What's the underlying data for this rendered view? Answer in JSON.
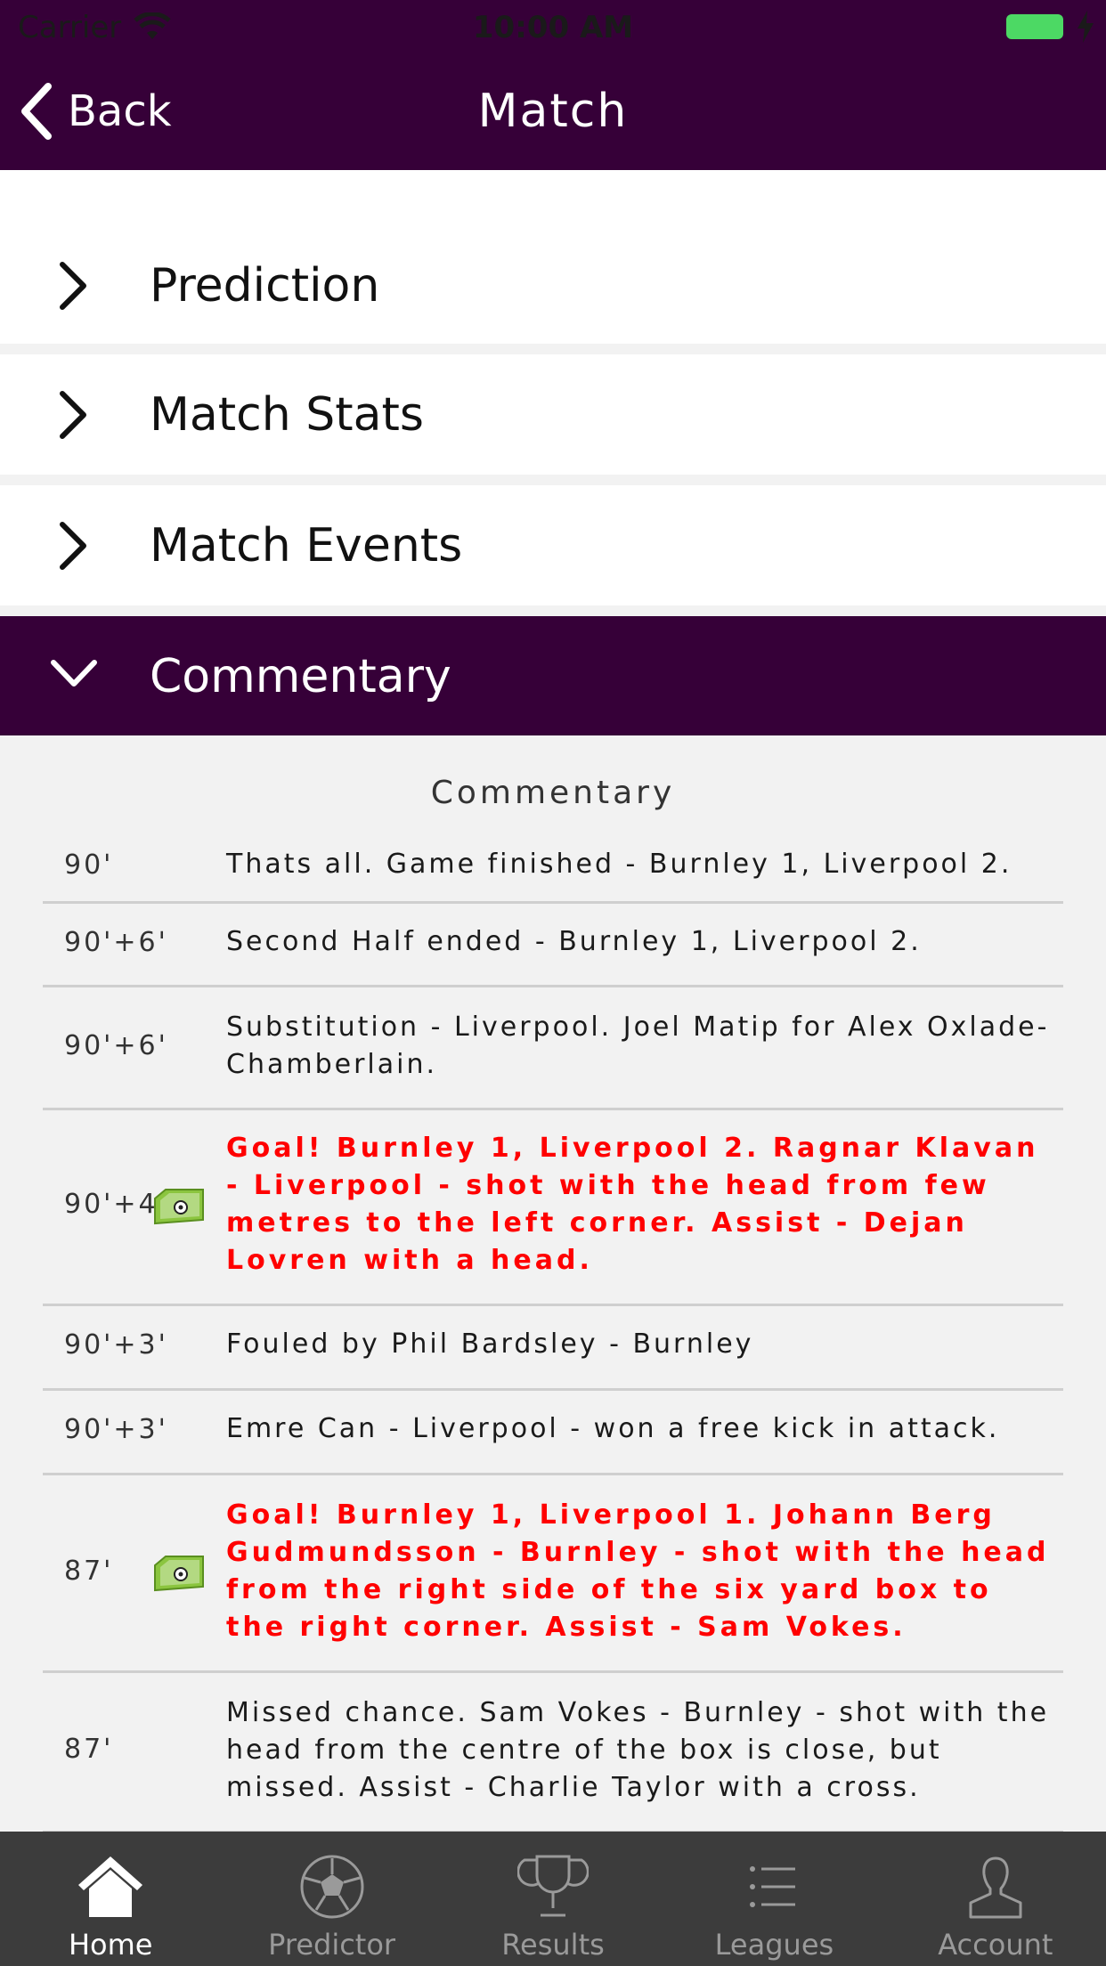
{
  "status_bar": {
    "carrier": "Carrier",
    "time": "10:00 AM"
  },
  "nav": {
    "back_label": "Back",
    "title": "Match"
  },
  "accordion": [
    {
      "label": "Prediction",
      "expanded": false
    },
    {
      "label": "Match Stats",
      "expanded": false
    },
    {
      "label": "Match Events",
      "expanded": false
    },
    {
      "label": "Commentary",
      "expanded": true
    }
  ],
  "commentary": {
    "header": "Commentary",
    "rows": [
      {
        "minute": "90'",
        "text": "Thats all. Game finished - Burnley 1, Liverpool 2.",
        "goal": false
      },
      {
        "minute": "90'+6'",
        "text": "Second Half ended - Burnley 1, Liverpool 2.",
        "goal": false
      },
      {
        "minute": "90'+6'",
        "text": "Substitution - Liverpool. Joel Matip for Alex Oxlade-Chamberlain.",
        "goal": false
      },
      {
        "minute": "90'+4'",
        "text": "Goal! Burnley 1, Liverpool 2. Ragnar Klavan - Liverpool - shot with the head from few metres to the left corner. Assist - Dejan Lovren with a head.",
        "goal": true
      },
      {
        "minute": "90'+3'",
        "text": "Fouled by Phil Bardsley - Burnley",
        "goal": false
      },
      {
        "minute": "90'+3'",
        "text": "Emre Can - Liverpool - won a free kick in attack.",
        "goal": false
      },
      {
        "minute": "87'",
        "text": "Goal! Burnley 1, Liverpool 1. Johann Berg Gudmundsson - Burnley - shot with the head from the right side of the six yard box to the right corner. Assist - Sam Vokes.",
        "goal": true
      },
      {
        "minute": "87'",
        "text": "Missed chance. Sam Vokes - Burnley - shot with the head from the centre of the box is close, but missed. Assist - Charlie Taylor with a cross.",
        "goal": false
      }
    ]
  },
  "tabs": [
    {
      "label": "Home",
      "icon": "home-icon",
      "active": true
    },
    {
      "label": "Predictor",
      "icon": "football-icon",
      "active": false
    },
    {
      "label": "Results",
      "icon": "trophy-icon",
      "active": false
    },
    {
      "label": "Leagues",
      "icon": "list-icon",
      "active": false
    },
    {
      "label": "Account",
      "icon": "person-icon",
      "active": false
    }
  ],
  "colors": {
    "brand": "#360038",
    "goal_text": "#ff0000",
    "tab_bar": "#3c3c3c"
  }
}
